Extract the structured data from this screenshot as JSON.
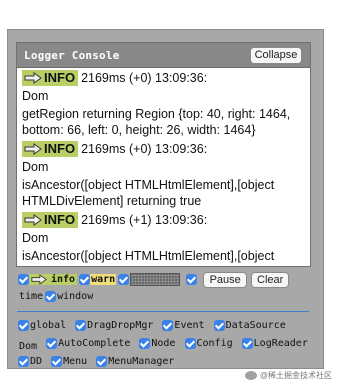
{
  "console": {
    "title": "Logger Console",
    "collapse_label": "Collapse",
    "entries": [
      {
        "level": "INFO",
        "time": "2169ms (+0) 13:09:36:",
        "source": "Dom",
        "message": "getRegion returning Region {top: 40, right: 1464, bottom: 66, left: 0, height: 26, width: 1464}"
      },
      {
        "level": "INFO",
        "time": "2169ms (+0) 13:09:36:",
        "source": "Dom",
        "message": "isAncestor([object HTMLHtmlElement],[object HTMLDivElement] returning true"
      },
      {
        "level": "INFO",
        "time": "2169ms (+1) 13:09:36:",
        "source": "Dom",
        "message": "isAncestor([object HTMLHtmlElement],[object HTMLDivElement] returning true"
      }
    ]
  },
  "level_filters": {
    "info_label": "info",
    "warn_label": "warn",
    "time_label": "time",
    "window_label": "window"
  },
  "buttons": {
    "pause_label": "Pause",
    "clear_label": "Clear"
  },
  "source_filters": [
    "global",
    "DragDropMgr",
    "Event",
    "DataSource",
    "Dom",
    "AutoComplete",
    "Node",
    "Config",
    "LogReader",
    "DD",
    "Menu",
    "MenuManager"
  ],
  "watermark": "@稀土掘金技术社区",
  "colors": {
    "info_badge": "#b9cf65",
    "warn_badge": "#f0de7a",
    "checkbox": "#3a82e8",
    "header": "#888888"
  }
}
